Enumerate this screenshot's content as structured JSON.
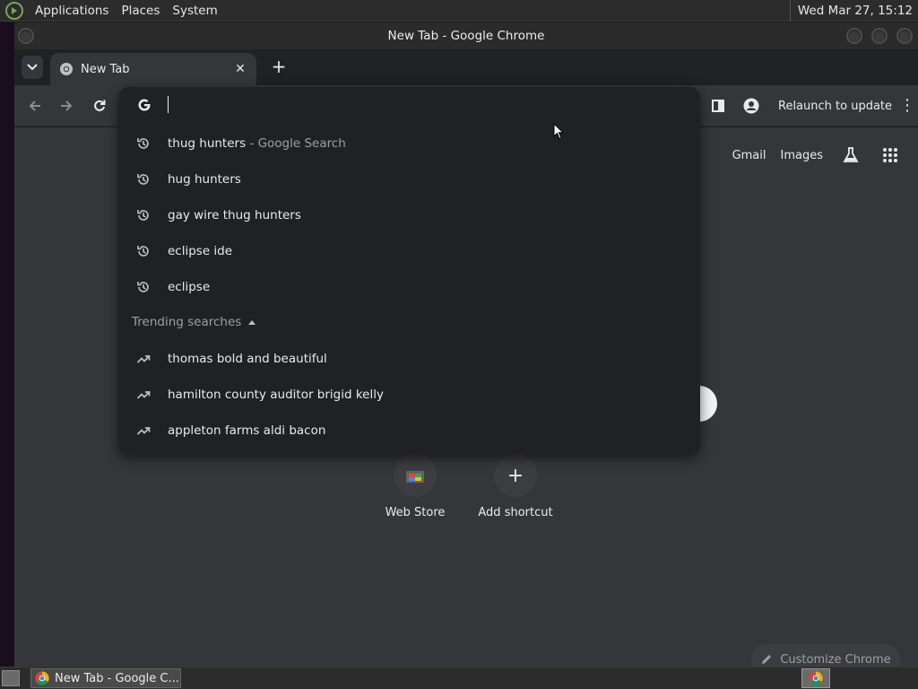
{
  "top_panel": {
    "menus": [
      "Applications",
      "Places",
      "System"
    ],
    "clock": "Wed Mar 27, 15:12"
  },
  "window": {
    "title": "New Tab - Google Chrome"
  },
  "tab": {
    "title": "New Tab",
    "close_glyph": "✕",
    "new_tab_glyph": "+"
  },
  "toolbar": {
    "relaunch_label": "Relaunch to update",
    "menu_glyph": "⋮"
  },
  "omnibox": {
    "input_value": "",
    "suggestions": [
      {
        "text": "thug hunters",
        "suffix": " - Google Search",
        "icon": "history-icon"
      },
      {
        "text": "hug hunters",
        "suffix": "",
        "icon": "history-icon"
      },
      {
        "text": "gay wire thug hunters",
        "suffix": "",
        "icon": "history-icon"
      },
      {
        "text": "eclipse ide",
        "suffix": "",
        "icon": "history-icon"
      },
      {
        "text": "eclipse",
        "suffix": "",
        "icon": "history-icon"
      }
    ],
    "trending_header": "Trending searches",
    "trending": [
      {
        "text": "thomas bold and beautiful",
        "icon": "trending-icon"
      },
      {
        "text": "hamilton county auditor brigid kelly",
        "icon": "trending-icon"
      },
      {
        "text": "appleton farms aldi bacon",
        "icon": "trending-icon"
      }
    ]
  },
  "ntp": {
    "links": [
      "Gmail",
      "Images"
    ],
    "shortcuts": [
      {
        "label": "Web Store",
        "icon": "web-store-icon"
      },
      {
        "label": "Add shortcut",
        "icon": "plus-icon"
      }
    ],
    "customize_label": "Customize Chrome"
  },
  "taskbar": {
    "task_label": "New Tab - Google C..."
  },
  "colors": {
    "chrome_dark": "#202124",
    "toolbar": "#35363a",
    "text": "#e8eaed",
    "muted": "#9aa0a6"
  }
}
